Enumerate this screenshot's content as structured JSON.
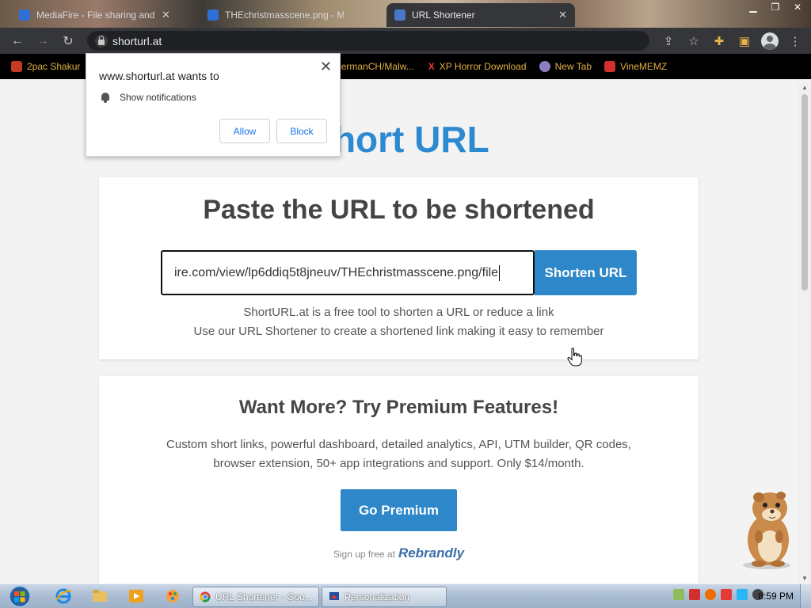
{
  "browser": {
    "tabs": [
      {
        "title": "MediaFire - File sharing and sto",
        "active": false
      },
      {
        "title": "THEchristmasscene.png - Media",
        "active": false
      },
      {
        "title": "URL Shortener",
        "active": true
      }
    ],
    "address": "shorturl.at",
    "bookmarks": [
      {
        "label": "2pac Shakur",
        "color": "#c23b22"
      },
      {
        "label": "EndermanCH/Malw...",
        "color": "#9b59b6"
      },
      {
        "label": "XP Horror Download",
        "color": "#e53935"
      },
      {
        "label": "New Tab",
        "color": "#8e7cc3"
      },
      {
        "label": "VineMEMZ",
        "color": "#d32f2f"
      }
    ]
  },
  "notification": {
    "title": "www.shorturl.at wants to",
    "permission": "Show notifications",
    "allow_label": "Allow",
    "block_label": "Block"
  },
  "page": {
    "brand": "Short URL",
    "card1": {
      "heading": "Paste the URL to be shortened",
      "input_value": "ire.com/view/lp6ddiq5t8jneuv/THEchristmasscene.png/file",
      "button_label": "Shorten URL",
      "desc1": "ShortURL.at is a free tool to shorten a URL or reduce a link",
      "desc2": "Use our URL Shortener to create a shortened link making it easy to remember"
    },
    "card2": {
      "heading": "Want More? Try Premium Features!",
      "text1": "Custom short links, powerful dashboard, detailed analytics, API, UTM builder, QR codes,",
      "text2": "browser extension, 50+ app integrations and support. Only $14/month.",
      "button_label": "Go Premium",
      "signup_text": "Sign up free at",
      "signup_brand": "Rebrandly"
    }
  },
  "taskbar": {
    "tasks": [
      {
        "label": "URL Shortener - Goo..."
      },
      {
        "label": "Personalization"
      }
    ],
    "clock": "8:59 PM"
  },
  "colors": {
    "accent": "#2e87c8",
    "brand": "#2d8ad1"
  }
}
